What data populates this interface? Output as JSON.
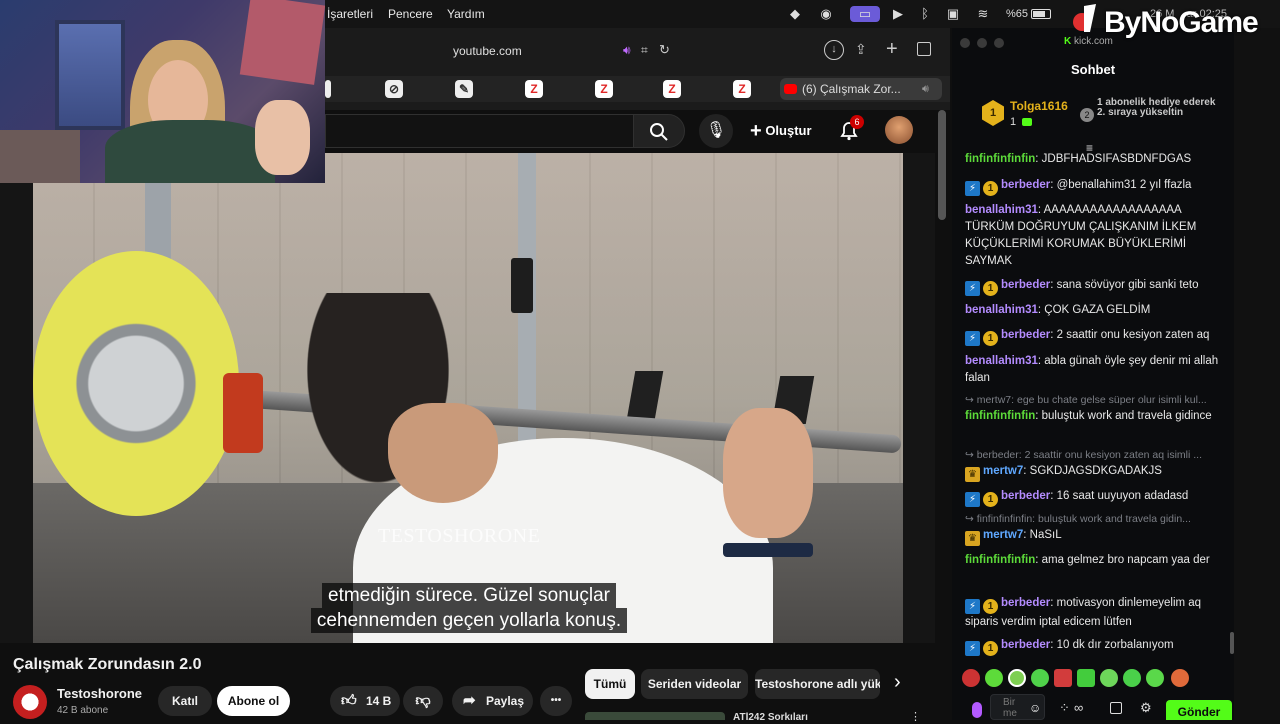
{
  "menubar": {
    "items": [
      "İşaretleri",
      "Pencere",
      "Yardım"
    ],
    "battery": "%65",
    "time_fragment": "26 M    ar 02:25"
  },
  "watermark": "ByNoGame",
  "browser": {
    "url": "youtube.com",
    "active_tab_title": "(6) Çalışmak Zor...",
    "new_tab_symbol": "+"
  },
  "youtube": {
    "create_label": "Oluştur",
    "notification_count": "6",
    "video_watermark": "TESTOSHORONE",
    "subtitle_line1": "etmediğin sürece. Güzel sonuçlar",
    "subtitle_line2": "cehennemden geçen yollarla konuş.",
    "video_title": "Çalışmak Zorundasın 2.0",
    "channel_name": "Testoshorone",
    "subscribers": "42 B abone",
    "join_label": "Katıl",
    "subscribe_label": "Abone ol",
    "likes": "14 B",
    "share_label": "Paylaş",
    "more_label": "•••",
    "chips": [
      "Tümü",
      "Seriden videolar",
      "Testoshorone adlı yük"
    ],
    "next_video_partial": "ATİ242 Sorkıları"
  },
  "kick": {
    "brand": "kick.com",
    "chat_title": "Sohbet",
    "top_gifter": "Tolga1616",
    "top_gifter_count": "1",
    "gift_notice": "1 abonelik hediye ederek 2. sıraya yükseltin",
    "gift_rank": "2",
    "input_placeholder": "Bir me",
    "send_label": "Gönder",
    "messages": [
      {
        "user": "finfinfinfinfin",
        "text": "JDBFHADSIFASBDNFDGAS",
        "color": "#5ddb3a"
      },
      {
        "user": "berbeder",
        "text": "@benallahim31 2 yıl ffazla",
        "color": "#b48cff"
      },
      {
        "user": "benallahim31",
        "text": "AAAAAAAAAAAAAAAAAA TÜRKÜM DOĞRUYUM ÇALIŞKANIM İLKEM KÜÇÜKLERİMİ KORUMAK BÜYÜKLERİMİ SAYMAK",
        "color": "#b48cff"
      },
      {
        "user": "berbeder",
        "text": "sana sövüyor gibi sanki teto",
        "color": "#b48cff"
      },
      {
        "user": "benallahim31",
        "text": "ÇOK GAZA GELDİM",
        "color": "#b48cff"
      },
      {
        "user": "berbeder",
        "text": "2 saattir onu kesiyon zaten aq",
        "color": "#b48cff"
      },
      {
        "user": "benallahim31",
        "text": "abla günah öyle şey denir mi allah falan",
        "color": "#b48cff"
      },
      {
        "reply": "mertw7: ege bu chate gelse süper olur isimli kul..."
      },
      {
        "user": "finfinfinfinfin",
        "text": "buluştuk work and travela gidince",
        "color": "#5ddb3a"
      },
      {
        "reply": "berbeder: 2 saattir onu kesiyon zaten aq isimli ..."
      },
      {
        "user": "mertw7",
        "text": "SGKDJAGSDKGADAKJS",
        "color": "#5fa8ff"
      },
      {
        "user": "berbeder",
        "text": "16 saat uuyuyon adadasd",
        "color": "#b48cff"
      },
      {
        "reply": "finfinfinfinfin: buluştuk work and travela gidin..."
      },
      {
        "user": "mertw7",
        "text": "NaSıL",
        "color": "#5fa8ff"
      },
      {
        "user": "finfinfinfinfin",
        "text": "ama gelmez bro napcam yaa der",
        "color": "#5ddb3a"
      },
      {
        "user": "berbeder",
        "text": "motivasyon dinlemeyelim aq siparis verdim iptal edicem lütfen",
        "color": "#b48cff"
      },
      {
        "user": "berbeder",
        "text": "10 dk dır zorbalanıyom",
        "color": "#b48cff"
      }
    ]
  },
  "colors": {
    "kick_green": "#53fc18",
    "yt_red": "#ff0000",
    "abone_bg": "#ffffff",
    "gold": "#e4b21b"
  }
}
